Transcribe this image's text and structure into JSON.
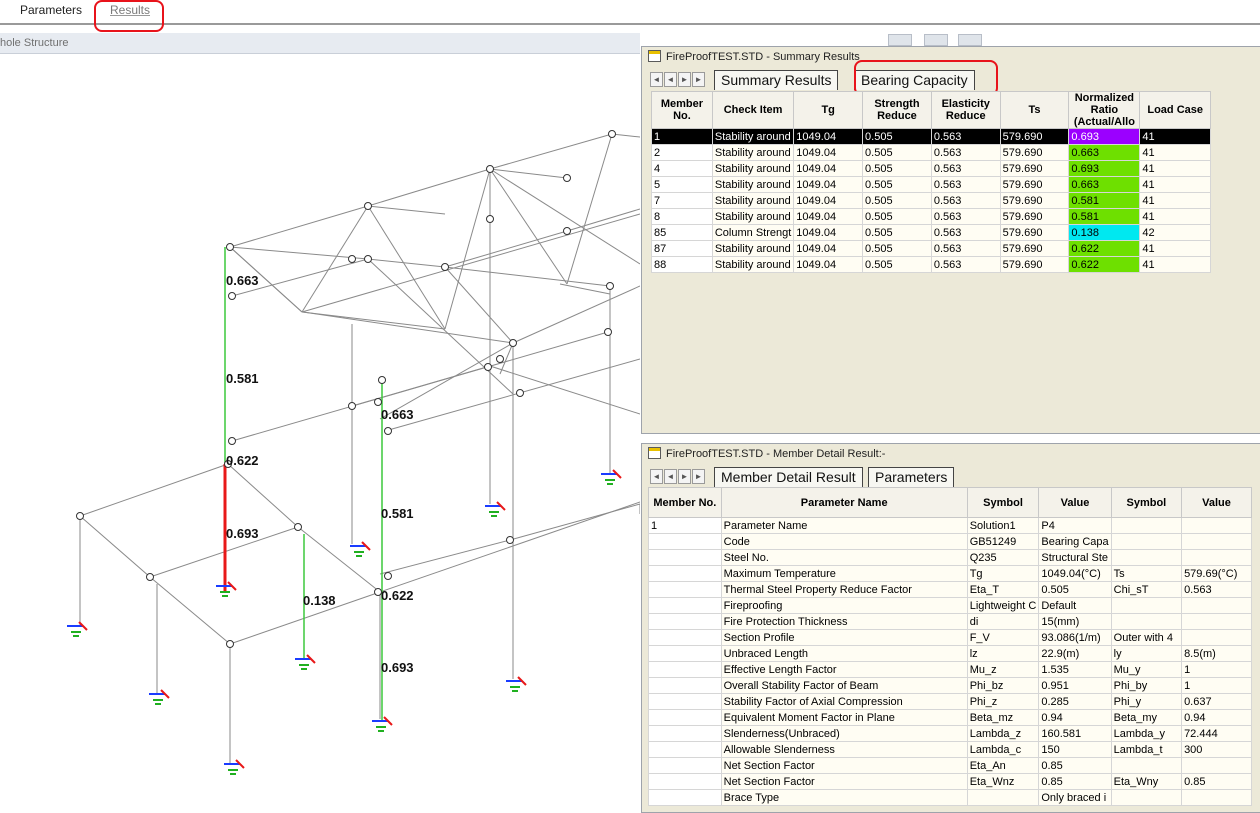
{
  "menu": {
    "tabs": [
      "Parameters",
      "Results"
    ]
  },
  "viewport": {
    "title": "hole Structure",
    "member_labels": [
      "0.663",
      "0.581",
      "0.622",
      "0.693",
      "0.663",
      "0.581",
      "0.138",
      "0.622",
      "0.693"
    ]
  },
  "summary_window": {
    "title": "FireProofTEST.STD - Summary Results",
    "tabs": [
      "Summary Results",
      "Bearing Capacity"
    ],
    "columns": [
      "Member No.",
      "Check Item",
      "Tg",
      "Strength Reduce",
      "Elasticity Reduce",
      "Ts",
      "Normalized Ratio (Actual/Allo",
      "Load Case"
    ],
    "rows": [
      {
        "member": "1",
        "item": "Stability around",
        "tg": "1049.04",
        "sr": "0.505",
        "er": "0.563",
        "ts": "579.690",
        "ratio": "0.693",
        "color": "#9b00ff",
        "lc": "41"
      },
      {
        "member": "2",
        "item": "Stability around",
        "tg": "1049.04",
        "sr": "0.505",
        "er": "0.563",
        "ts": "579.690",
        "ratio": "0.663",
        "color": "#6ee000",
        "lc": "41"
      },
      {
        "member": "4",
        "item": "Stability around",
        "tg": "1049.04",
        "sr": "0.505",
        "er": "0.563",
        "ts": "579.690",
        "ratio": "0.693",
        "color": "#6ee000",
        "lc": "41"
      },
      {
        "member": "5",
        "item": "Stability around",
        "tg": "1049.04",
        "sr": "0.505",
        "er": "0.563",
        "ts": "579.690",
        "ratio": "0.663",
        "color": "#6ee000",
        "lc": "41"
      },
      {
        "member": "7",
        "item": "Stability around",
        "tg": "1049.04",
        "sr": "0.505",
        "er": "0.563",
        "ts": "579.690",
        "ratio": "0.581",
        "color": "#6ee000",
        "lc": "41"
      },
      {
        "member": "8",
        "item": "Stability around",
        "tg": "1049.04",
        "sr": "0.505",
        "er": "0.563",
        "ts": "579.690",
        "ratio": "0.581",
        "color": "#6ee000",
        "lc": "41"
      },
      {
        "member": "85",
        "item": "Column Strengt",
        "tg": "1049.04",
        "sr": "0.505",
        "er": "0.563",
        "ts": "579.690",
        "ratio": "0.138",
        "color": "#00e8f0",
        "lc": "42"
      },
      {
        "member": "87",
        "item": "Stability around",
        "tg": "1049.04",
        "sr": "0.505",
        "er": "0.563",
        "ts": "579.690",
        "ratio": "0.622",
        "color": "#6ee000",
        "lc": "41"
      },
      {
        "member": "88",
        "item": "Stability around",
        "tg": "1049.04",
        "sr": "0.505",
        "er": "0.563",
        "ts": "579.690",
        "ratio": "0.622",
        "color": "#6ee000",
        "lc": "41"
      }
    ]
  },
  "detail_window": {
    "title": "FireProofTEST.STD - Member Detail Result:-",
    "tabs": [
      "Member Detail Result",
      "Parameters"
    ],
    "columns": [
      "Member No.",
      "Parameter Name",
      "Symbol",
      "Value",
      "Symbol",
      "Value"
    ],
    "rows": [
      [
        "1",
        "Parameter Name",
        "Solution1",
        "P4",
        "",
        ""
      ],
      [
        "",
        "Code",
        "GB51249",
        "Bearing Capa",
        "",
        ""
      ],
      [
        "",
        "Steel No.",
        "Q235",
        "Structural Ste",
        "",
        ""
      ],
      [
        "",
        "Maximum Temperature",
        "Tg",
        "1049.04(°C)",
        "Ts",
        "579.69(°C)"
      ],
      [
        "",
        "Thermal Steel Property Reduce Factor",
        "Eta_T",
        "0.505",
        "Chi_sT",
        "0.563"
      ],
      [
        "",
        "Fireproofing",
        "Lightweight C",
        "Default",
        "",
        ""
      ],
      [
        "",
        "Fire Protection Thickness",
        "di",
        "15(mm)",
        "",
        ""
      ],
      [
        "",
        "Section Profile",
        "F_V",
        "93.086(1/m)",
        "Outer with 4",
        ""
      ],
      [
        "",
        "Unbraced Length",
        "lz",
        "22.9(m)",
        "ly",
        "8.5(m)"
      ],
      [
        "",
        "Effective Length Factor",
        "Mu_z",
        "1.535",
        "Mu_y",
        "1"
      ],
      [
        "",
        "Overall Stability Factor of Beam",
        "Phi_bz",
        "0.951",
        "Phi_by",
        "1"
      ],
      [
        "",
        "Stability Factor of Axial Compression",
        "Phi_z",
        "0.285",
        "Phi_y",
        "0.637"
      ],
      [
        "",
        "Equivalent Moment Factor in Plane",
        "Beta_mz",
        "0.94",
        "Beta_my",
        "0.94"
      ],
      [
        "",
        "Slenderness(Unbraced)",
        "Lambda_z",
        "160.581",
        "Lambda_y",
        "72.444"
      ],
      [
        "",
        "Allowable Slenderness",
        "Lambda_c",
        "150",
        "Lambda_t",
        "300"
      ],
      [
        "",
        "Net Section Factor",
        "Eta_An",
        "0.85",
        "",
        ""
      ],
      [
        "",
        "Net Section Factor",
        "Eta_Wnz",
        "0.85",
        "Eta_Wny",
        "0.85"
      ],
      [
        "",
        "Brace Type",
        "",
        "Only braced i",
        "",
        ""
      ]
    ]
  }
}
